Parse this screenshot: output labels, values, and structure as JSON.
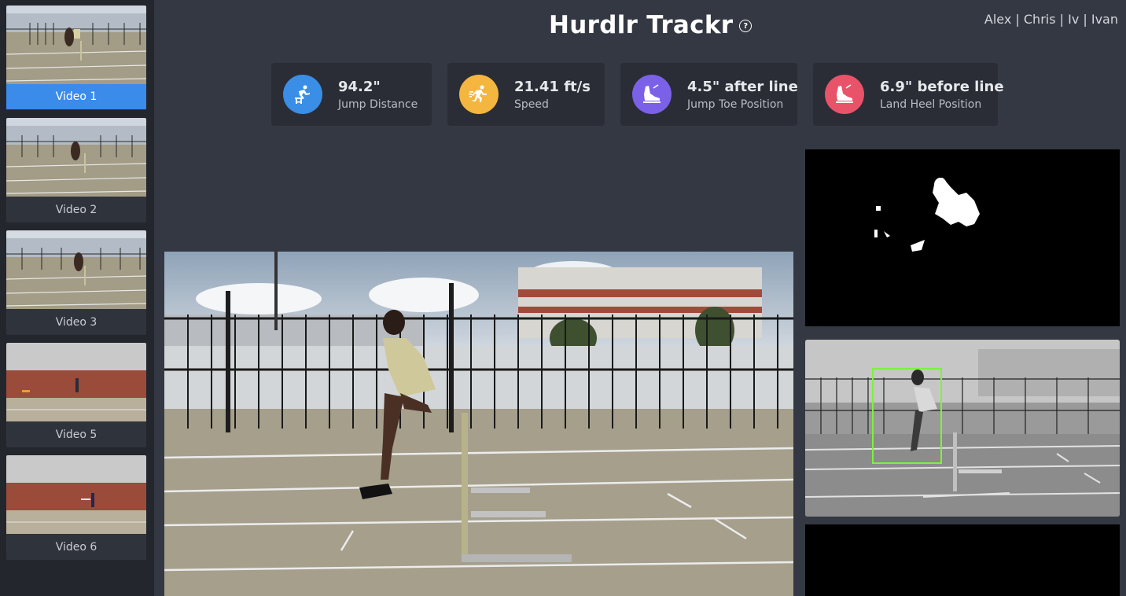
{
  "header": {
    "title": "Hurdlr Trackr",
    "help_icon": "?",
    "authors": "Alex | Chris | Iv | Ivan"
  },
  "sidebar": {
    "videos": [
      {
        "label": "Video 1",
        "active": true
      },
      {
        "label": "Video 2",
        "active": false
      },
      {
        "label": "Video 3",
        "active": false
      },
      {
        "label": "Video 5",
        "active": false
      },
      {
        "label": "Video 6",
        "active": false
      }
    ]
  },
  "stats": [
    {
      "value": "94.2\"",
      "label": "Jump Distance",
      "icon": "hurdler-icon",
      "color": "#3a8ee6"
    },
    {
      "value": "21.41 ft/s",
      "label": "Speed",
      "icon": "runner-icon",
      "color": "#f4b63f"
    },
    {
      "value": "4.5\" after line",
      "label": "Jump Toe Position",
      "icon": "shoe-icon",
      "color": "#7b61e8"
    },
    {
      "value": "6.9\" before line",
      "label": "Land Heel Position",
      "icon": "shoe-icon",
      "color": "#e8536a"
    }
  ],
  "colors": {
    "background": "#343842",
    "sidebar": "#23262d",
    "card": "#2a2d35",
    "active": "#3b8bea",
    "tracking_box": "#7cf23c"
  }
}
